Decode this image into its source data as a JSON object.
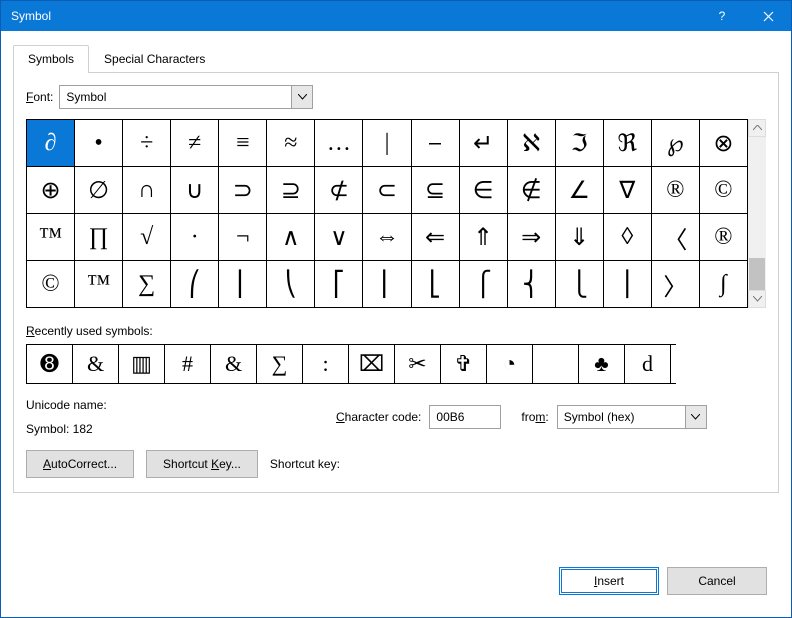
{
  "window": {
    "title": "Symbol"
  },
  "tabs": [
    {
      "label": "Symbols",
      "active": true
    },
    {
      "label": "Special Characters",
      "active": false
    }
  ],
  "font": {
    "label": "Font:",
    "value": "Symbol"
  },
  "grid": {
    "selected_index": 0,
    "rows": [
      [
        "∂",
        "•",
        "÷",
        "≠",
        "≡",
        "≈",
        "…",
        "|",
        "⎯",
        "↵",
        "ℵ",
        "ℑ",
        "ℜ",
        "℘",
        "⊗"
      ],
      [
        "⊕",
        "∅",
        "∩",
        "∪",
        "⊃",
        "⊇",
        "⊄",
        "⊂",
        "⊆",
        "∈",
        "∉",
        "∠",
        "∇",
        "®",
        "©"
      ],
      [
        "™",
        "∏",
        "√",
        "·",
        "¬",
        "∧",
        "∨",
        "⇔",
        "⇐",
        "⇑",
        "⇒",
        "⇓",
        "◊",
        "〈",
        "®"
      ],
      [
        "©",
        "™",
        "∑",
        "⎛",
        "⎜",
        "⎝",
        "⎡",
        "⎢",
        "⎣",
        "⎧",
        "⎨",
        "⎩",
        "⎪",
        "〉",
        "∫"
      ]
    ]
  },
  "recent": {
    "label": "Recently used symbols:",
    "items": [
      "➑",
      "&",
      "▥",
      "#",
      "&",
      "∑",
      ":",
      "⌧",
      "✂",
      "✞",
      "◔",
      "",
      "♣",
      "d"
    ]
  },
  "unicode": {
    "label": "Unicode name:",
    "value": "Symbol: 182"
  },
  "charcode": {
    "label": "Character code:",
    "value": "00B6"
  },
  "from": {
    "label": "from:",
    "value": "Symbol (hex)"
  },
  "buttons": {
    "autocorrect": "AutoCorrect...",
    "shortcut": "Shortcut Key...",
    "shortcut_label": "Shortcut key:"
  },
  "footer": {
    "insert": "Insert",
    "cancel": "Cancel"
  }
}
